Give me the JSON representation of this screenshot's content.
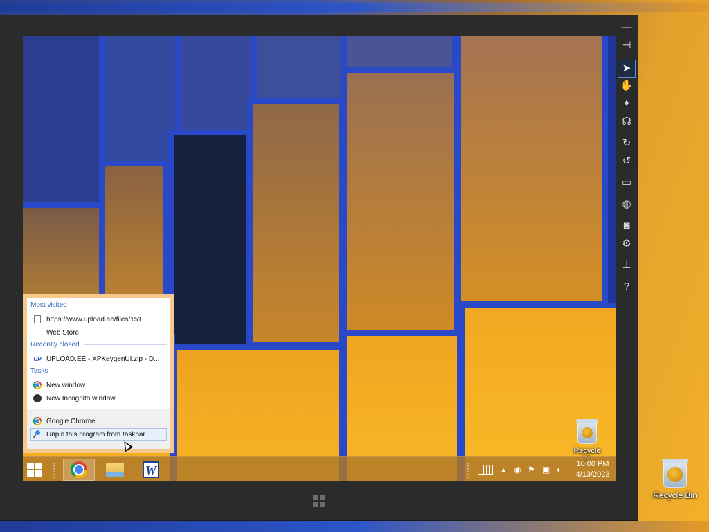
{
  "desktop": {
    "recycle_bin_label": "Recycle Bin"
  },
  "vm_toolbar": {
    "buttons": [
      {
        "name": "minimize-icon",
        "glyph": "—"
      },
      {
        "name": "pin-icon",
        "glyph": "⊣"
      },
      {
        "name": "pointer-icon",
        "glyph": "➤"
      },
      {
        "name": "hand-icon",
        "glyph": "✋"
      },
      {
        "name": "zoom-icon",
        "glyph": "✦"
      },
      {
        "name": "swipe-icon",
        "glyph": "☊"
      },
      {
        "name": "rotate-right-icon",
        "glyph": "↻"
      },
      {
        "name": "rotate-left-icon",
        "glyph": "↺"
      },
      {
        "name": "monitor-icon",
        "glyph": "▭"
      },
      {
        "name": "globe-icon",
        "glyph": "◍"
      },
      {
        "name": "camera-icon",
        "glyph": "◙"
      },
      {
        "name": "settings-icon",
        "glyph": "⚙"
      },
      {
        "name": "accelerometer-icon",
        "glyph": "⊥"
      },
      {
        "name": "help-icon",
        "glyph": "?"
      }
    ]
  },
  "guest": {
    "recycle_bin_label": "Recycle Bin",
    "clock": {
      "time": "10:00 PM",
      "date": "4/13/2023"
    },
    "taskbar_apps": [
      "chrome-icon",
      "file-explorer-icon",
      "word-icon"
    ]
  },
  "jumplist": {
    "most_visited_header": "Most visited",
    "most_visited": [
      "https://www.upload.ee/files/151...",
      "Web Store"
    ],
    "recently_closed_header": "Recently closed",
    "recently_closed": [
      "UPLOAD.EE - XPKeygenUI.zip - D..."
    ],
    "tasks_header": "Tasks",
    "tasks": [
      "New window",
      "New Incognito window"
    ],
    "footer": [
      "Google Chrome",
      "Unpin this program from taskbar"
    ]
  },
  "colors": {
    "jumplist_border": "#f7c88c",
    "section_header": "#2f63b8",
    "vm_frame": "#2b2b2b"
  }
}
